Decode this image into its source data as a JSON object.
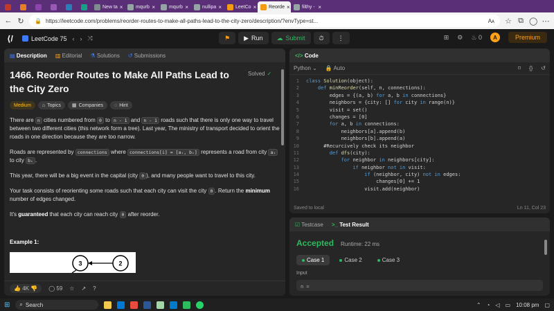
{
  "browser": {
    "tabs": [
      {
        "label": "",
        "color": "#c0392b"
      },
      {
        "label": "",
        "color": "#e67e22"
      },
      {
        "label": "",
        "color": "#8e44ad"
      },
      {
        "label": "",
        "color": "#9b59b6"
      },
      {
        "label": "",
        "color": "#2980b9"
      },
      {
        "label": "",
        "color": "#16a085"
      },
      {
        "label": "New ta",
        "color": "#7f8c8d"
      },
      {
        "label": "mqurb",
        "color": "#95a5a6"
      },
      {
        "label": "mqurb",
        "color": "#95a5a6"
      },
      {
        "label": "nullipa",
        "color": "#95a5a6"
      },
      {
        "label": "LeetCo",
        "color": "#f39c12"
      },
      {
        "label": "Reorde",
        "color": "#f39c12"
      },
      {
        "label": "filthy -",
        "color": "#95a5a6"
      }
    ],
    "url": "https://leetcode.com/problems/reorder-routes-to-make-all-paths-lead-to-the-city-zero/description/?envType=st...",
    "reader_icon": "Aᴀ"
  },
  "leetcode": {
    "logo": "LeetCode 75",
    "run": "Run",
    "submit": "Submit",
    "coins": "0",
    "premium": "Premium",
    "avatar_letter": "A"
  },
  "description": {
    "tabs": [
      "Description",
      "Editorial",
      "Solutions",
      "Submissions"
    ],
    "title": "1466. Reorder Routes to Make All Paths Lead to the City Zero",
    "solved": "Solved",
    "chips": [
      "Medium",
      "Topics",
      "Companies",
      "Hint"
    ],
    "p1_a": "There are ",
    "p1_n": "n",
    "p1_b": " cities numbered from ",
    "p1_0": "0",
    "p1_c": " to ",
    "p1_n1": "n - 1",
    "p1_d": " and ",
    "p1_n2": "n - 1",
    "p1_e": " roads such that there is only one way to travel between two different cities (this network form a tree). Last year, The ministry of transport decided to orient the roads in one direction because they are too narrow.",
    "p2_a": "Roads are represented by ",
    "p2_conn": "connections",
    "p2_b": " where ",
    "p2_ci": "connections[i] = [aᵢ, bᵢ]",
    "p2_c": " represents a road from city ",
    "p2_ai": "aᵢ",
    "p2_d": " to city ",
    "p2_bi": "bᵢ",
    "p2_e": ".",
    "p3_a": "This year, there will be a big event in the capital (city ",
    "p3_0": "0",
    "p3_b": "), and many people want to travel to this city.",
    "p4_a": "Your task consists of reorienting some roads such that each city can visit the city ",
    "p4_0": "0",
    "p4_b": ". Return the ",
    "p4_min": "minimum",
    "p4_c": " number of edges changed.",
    "p5_a": "It's ",
    "p5_g": "guaranteed",
    "p5_b": " that each city can reach city ",
    "p5_0": "0",
    "p5_c": " after reorder.",
    "example": "Example 1:",
    "node3": "3",
    "node2": "2",
    "likes": "4K",
    "comments": "59"
  },
  "code": {
    "header": "Code",
    "language": "Python",
    "auto": "Auto",
    "lines": [
      {
        "n": "1",
        "t": "class Solution(object):"
      },
      {
        "n": "2",
        "t": "    def minReorder(self, n, connections):"
      },
      {
        "n": "3",
        "t": "        edges = {(a, b) for a, b in connections}"
      },
      {
        "n": "4",
        "t": "        neighbors = {city: [] for city in range(n)}"
      },
      {
        "n": "5",
        "t": "        visit = set()"
      },
      {
        "n": "6",
        "t": "        changes = [0]"
      },
      {
        "n": "7",
        "t": "        for a, b in connections:"
      },
      {
        "n": "8",
        "t": "            neighbors[a].append(b)"
      },
      {
        "n": "9",
        "t": "            neighbors[b].append(a)"
      },
      {
        "n": "10",
        "t": "      #Recurcively check its neighbor"
      },
      {
        "n": "11",
        "t": "        def dfs(city):"
      },
      {
        "n": "12",
        "t": "            for neighbor in neighbors[city]:"
      },
      {
        "n": "13",
        "t": "                if neighbor not in visit:"
      },
      {
        "n": "14",
        "t": "                    if (neighbor, city) not in edges:"
      },
      {
        "n": "15",
        "t": "                        changes[0] += 1"
      },
      {
        "n": "16",
        "t": "                    visit.add(neighbor)"
      }
    ],
    "saved": "Saved to local",
    "cursor": "Ln 11, Col 23"
  },
  "result": {
    "tab_testcase": "Testcase",
    "tab_result": "Test Result",
    "status": "Accepted",
    "runtime": "Runtime: 22 ms",
    "cases": [
      "Case 1",
      "Case 2",
      "Case 3"
    ],
    "input_label": "Input",
    "input_value": "n ="
  },
  "taskbar": {
    "search": "Search",
    "time": "10:08 pm"
  }
}
